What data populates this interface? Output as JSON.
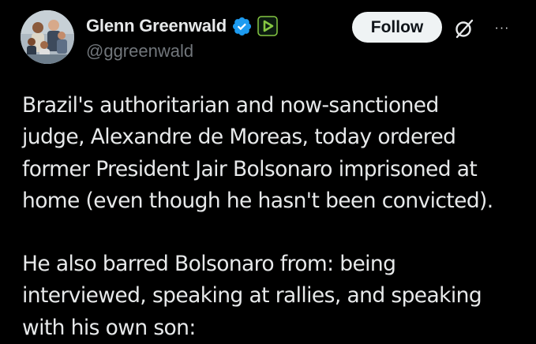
{
  "author": {
    "display_name": "Glenn Greenwald",
    "handle": "@ggreenwald",
    "verified_icon": "verified-badge-icon",
    "affiliate_icon": "rumble-affiliate-icon"
  },
  "actions": {
    "follow_label": "Follow",
    "grok_icon": "grok-icon",
    "more_icon": "more-options-icon",
    "more_glyph": "···"
  },
  "tweet": {
    "paragraph1_lines": [
      "Brazil's authoritarian and now-sanctioned",
      "judge, Alexandre de Moreas, today ordered",
      "former President Jair Bolsonaro imprisoned at",
      "home (even though he hasn't been convicted)."
    ],
    "paragraph2_lines": [
      "He also barred Bolsonaro from: being",
      "interviewed, speaking at rallies, and speaking",
      "with his own son:"
    ]
  },
  "colors": {
    "background": "#000000",
    "text_primary": "#e7e9ea",
    "text_secondary": "#71767b",
    "verified_blue": "#1d9bf0",
    "affiliate_green": "#85c742",
    "follow_bg": "#eff3f4"
  }
}
